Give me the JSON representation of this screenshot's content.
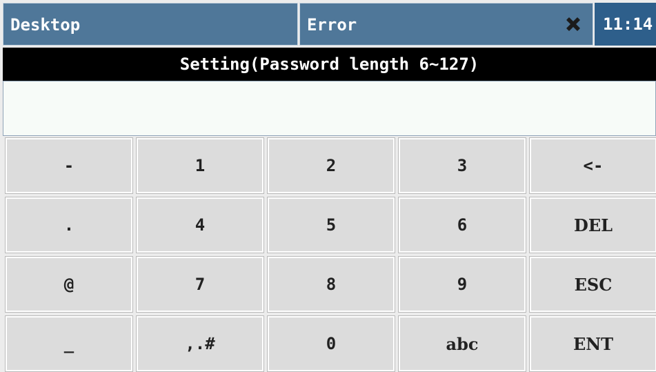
{
  "taskbar": {
    "desktop_label": "Desktop",
    "error_label": "Error",
    "close_icon": "close-x-icon",
    "clock": "11:14"
  },
  "dialog": {
    "title": "Setting(Password length 6~127)",
    "input_value": ""
  },
  "keypad": {
    "rows": [
      [
        "-",
        "1",
        "2",
        "3",
        "<-"
      ],
      [
        ".",
        "4",
        "5",
        "6",
        "DEL"
      ],
      [
        "@",
        "7",
        "8",
        "9",
        "ESC"
      ],
      [
        "_",
        ",.#",
        "0",
        "abc",
        "ENT"
      ]
    ]
  },
  "colors": {
    "taskbar_tab": "#4f7799",
    "clock_bg": "#2e5f8b",
    "title_bg": "#000000",
    "key_bg": "#dcdcdc"
  }
}
